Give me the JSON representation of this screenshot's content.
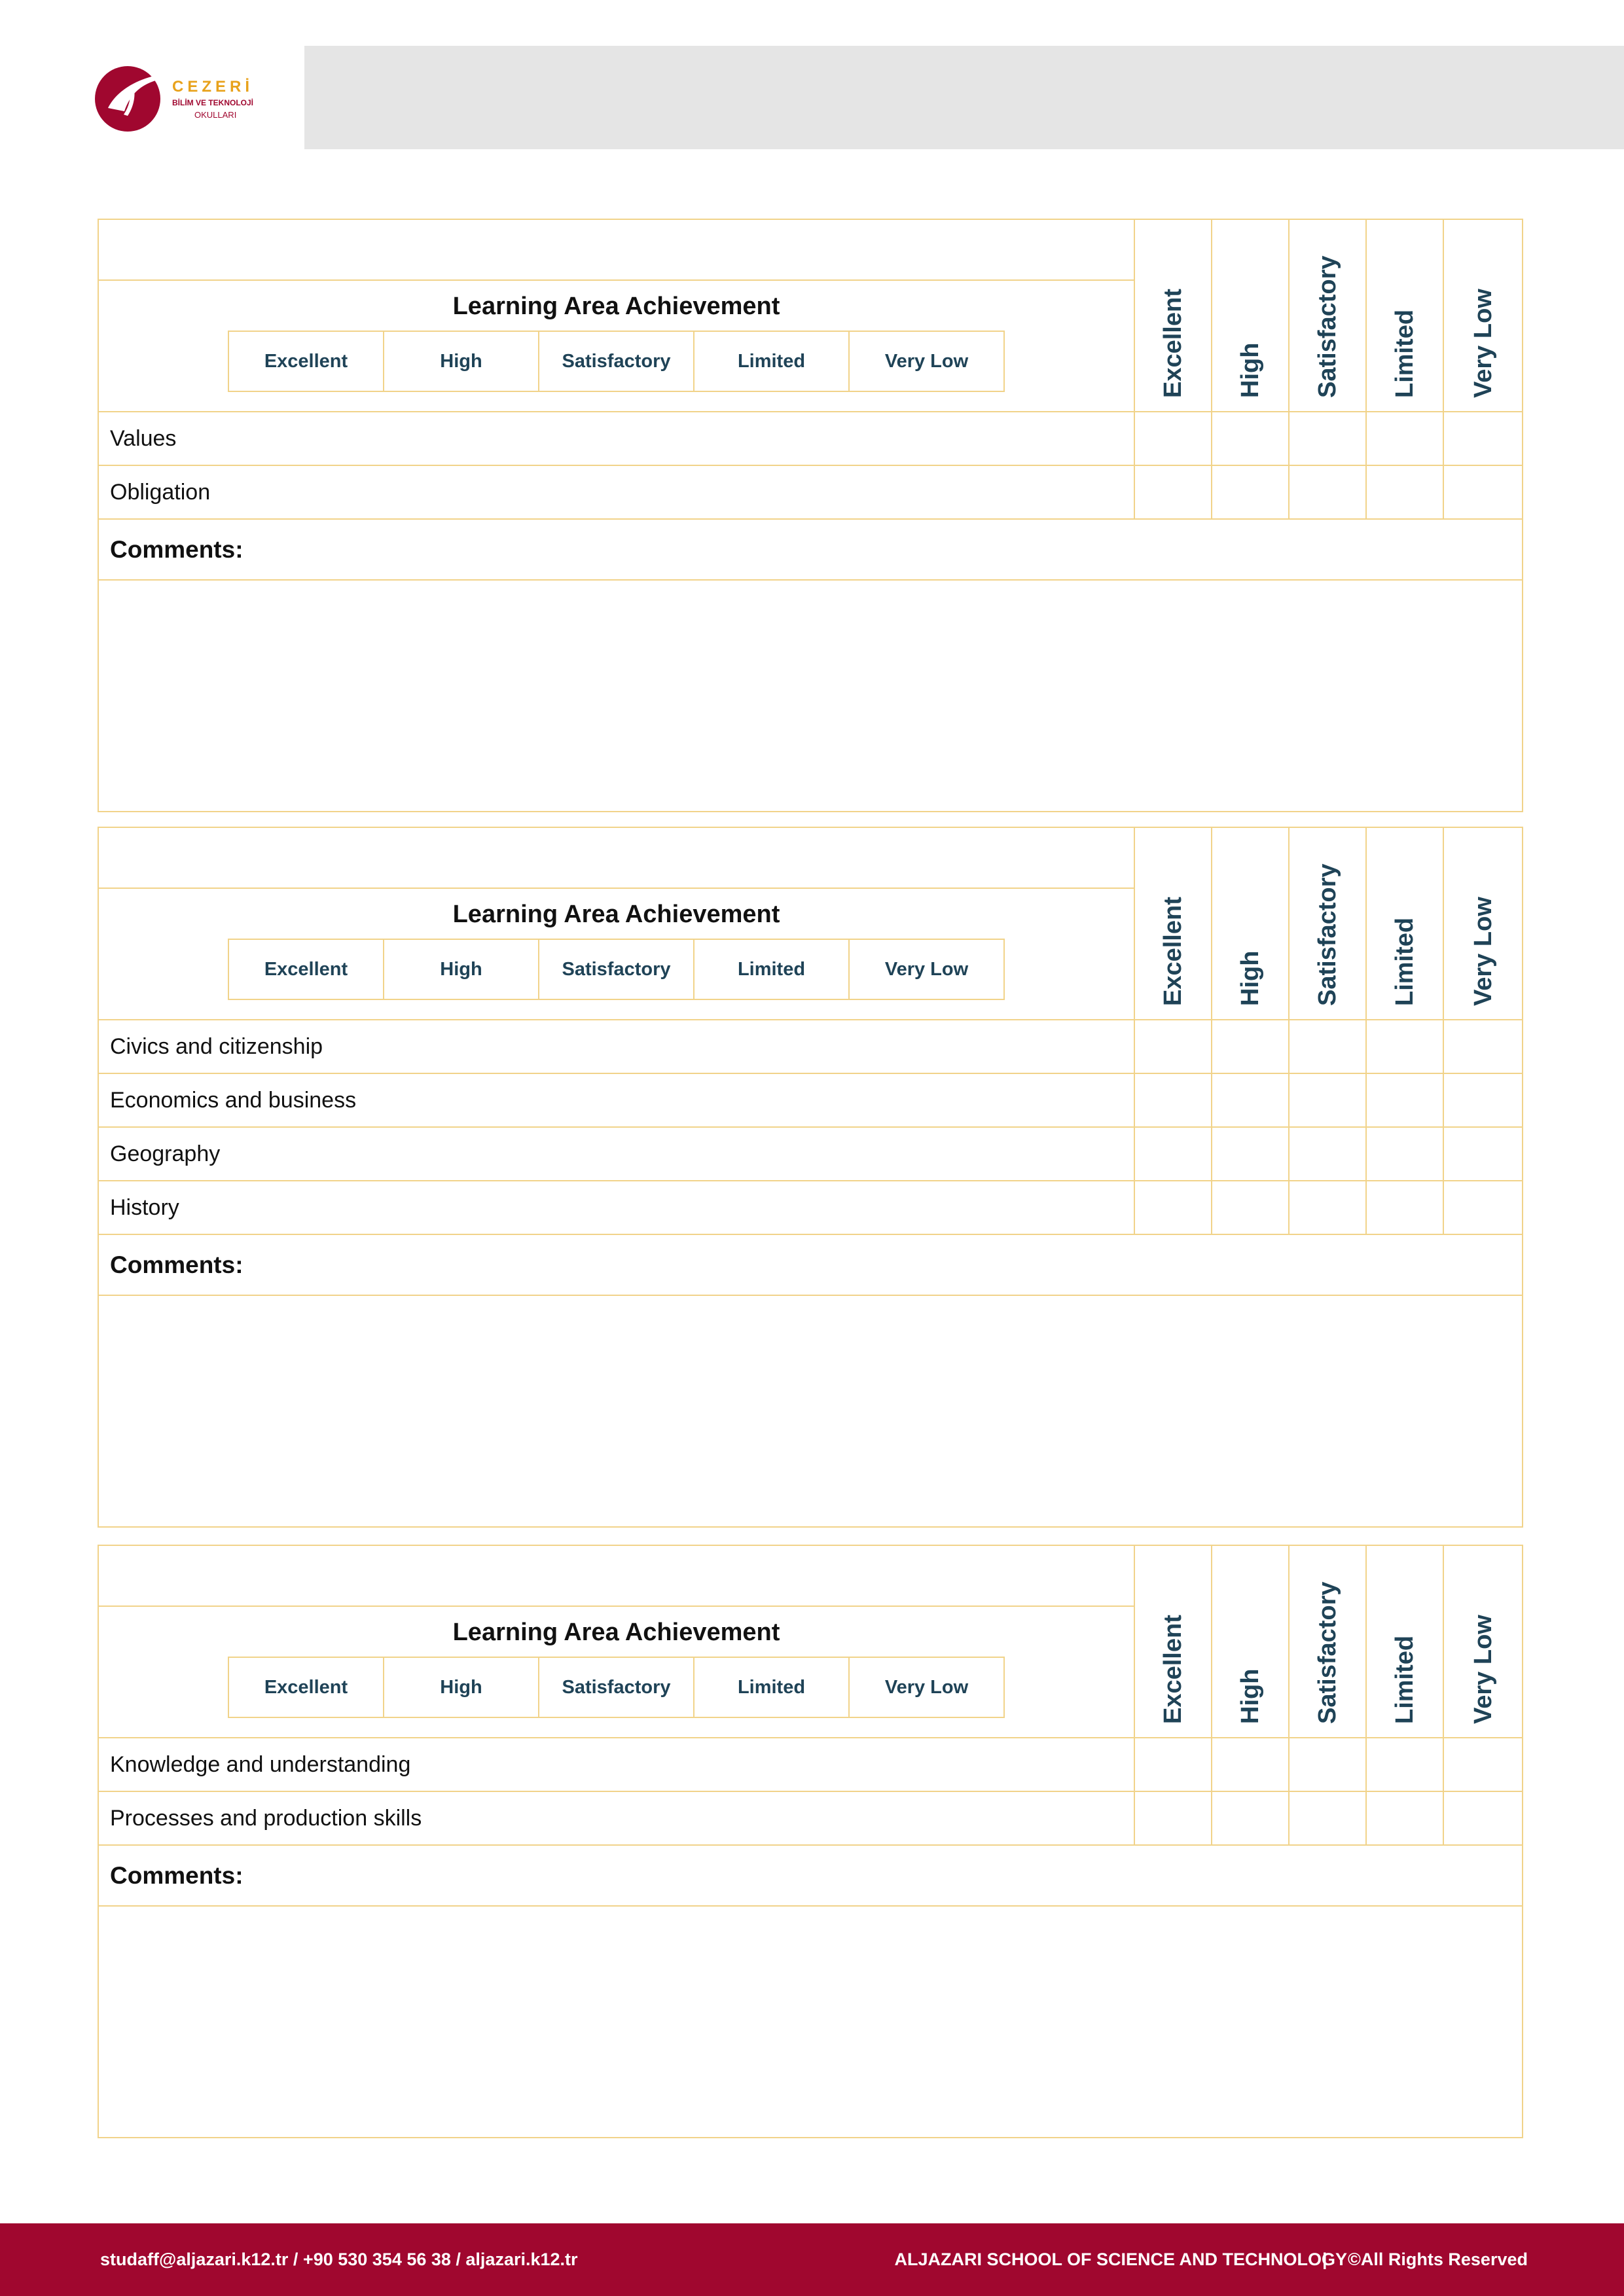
{
  "logo": {
    "brand": "CEZERİ",
    "line2": "BİLİM VE TEKNOLOJİ",
    "line3": "OKULLARI"
  },
  "rating_levels": [
    "Excellent",
    "High",
    "Satisfactory",
    "Limited",
    "Very Low"
  ],
  "sections": [
    {
      "heading": "Learning Area Achievement",
      "rows": [
        "Values",
        "Obligation"
      ],
      "comments_label": "Comments:"
    },
    {
      "heading": "Learning Area Achievement",
      "rows": [
        "Civics and citizenship",
        "Economics and business",
        "Geography",
        "History"
      ],
      "comments_label": "Comments:"
    },
    {
      "heading": "Learning Area Achievement",
      "rows": [
        "Knowledge and understanding",
        "Processes and production skills"
      ],
      "comments_label": "Comments:"
    }
  ],
  "footer": {
    "contact": "studaff@aljazari.k12.tr / +90 530 354 56 38 / aljazari.k12.tr",
    "school": "ALJAZARI SCHOOL OF SCIENCE AND TECHNOLOGY",
    "separator": "|",
    "rights": "©All Rights Reserved"
  },
  "colors": {
    "border": "#f1d38a",
    "label_text": "#1f4357",
    "footer_bg": "#a0072f",
    "logo_crimson": "#a0072f",
    "logo_gold": "#e8a21c"
  }
}
